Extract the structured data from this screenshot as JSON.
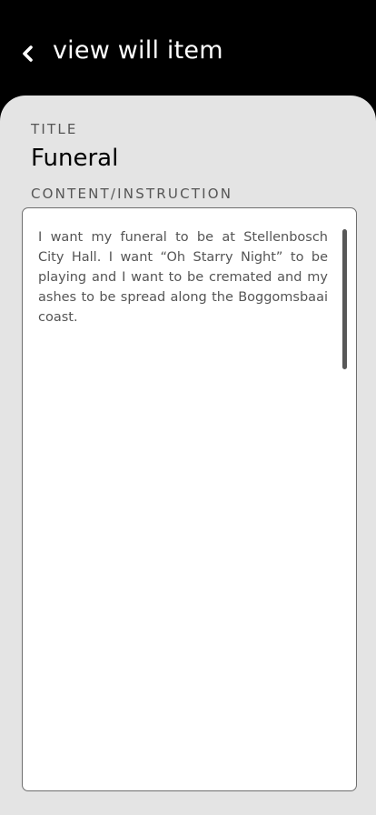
{
  "header": {
    "back_icon": "chevron-left-icon",
    "title": "view will item"
  },
  "form": {
    "title_label": "TITLE",
    "title_value": "Funeral",
    "content_label": "CONTENT/INSTRUCTION",
    "content_value": "I want my funeral to be at Stellenbosch City Hall. I want “Oh Starry Night” to be playing and I want to be cremated and my ashes to be spread along the Boggomsbaai coast."
  },
  "colors": {
    "header_bg": "#000000",
    "card_bg": "#e4e4e4",
    "field_bg": "#ffffff",
    "label_text": "#555555",
    "title_text": "#000000"
  }
}
